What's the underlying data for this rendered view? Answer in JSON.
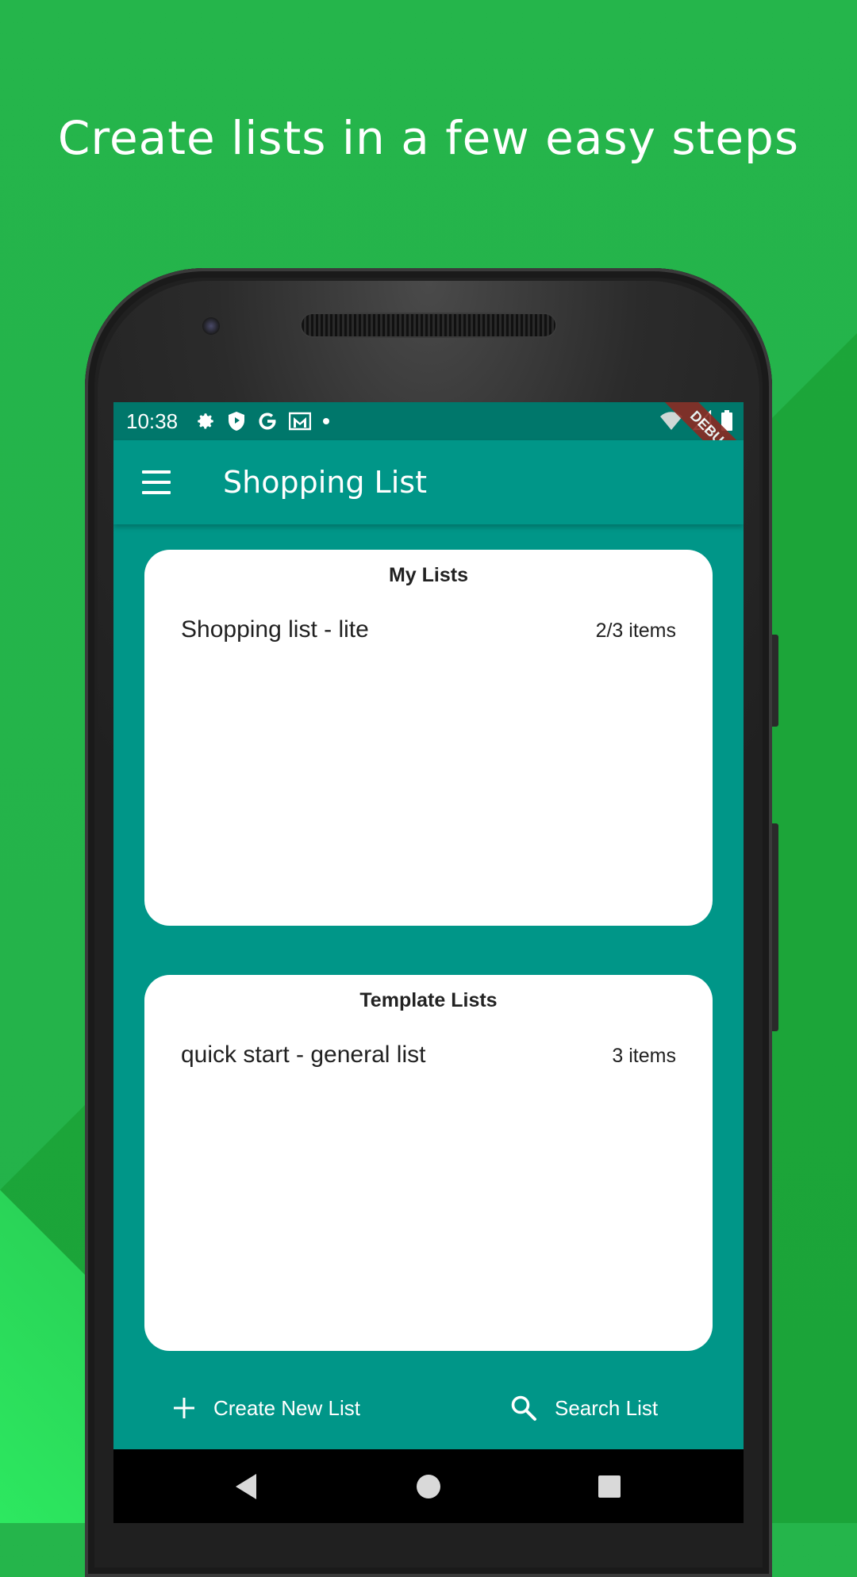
{
  "headline": "Create lists in a few easy steps",
  "status_bar": {
    "time": "10:38",
    "debug_label": "DEBUG",
    "icons": [
      "settings-icon",
      "shield-icon",
      "google-icon",
      "gmail-icon",
      "dot-icon",
      "wifi-icon",
      "signal-icon",
      "battery-icon"
    ]
  },
  "app_bar": {
    "title": "Shopping List",
    "menu_icon": "menu-icon"
  },
  "my_lists": {
    "title": "My Lists",
    "items": [
      {
        "name": "Shopping list - lite",
        "count": "2/3 items"
      }
    ]
  },
  "template_lists": {
    "title": "Template Lists",
    "items": [
      {
        "name": "quick start - general list",
        "count": "3 items"
      }
    ]
  },
  "actions": {
    "create_label": "Create New List",
    "search_label": "Search List"
  },
  "colors": {
    "background": "#25b54b",
    "primary": "#009688",
    "status_bar": "#00776b",
    "card": "#ffffff"
  }
}
